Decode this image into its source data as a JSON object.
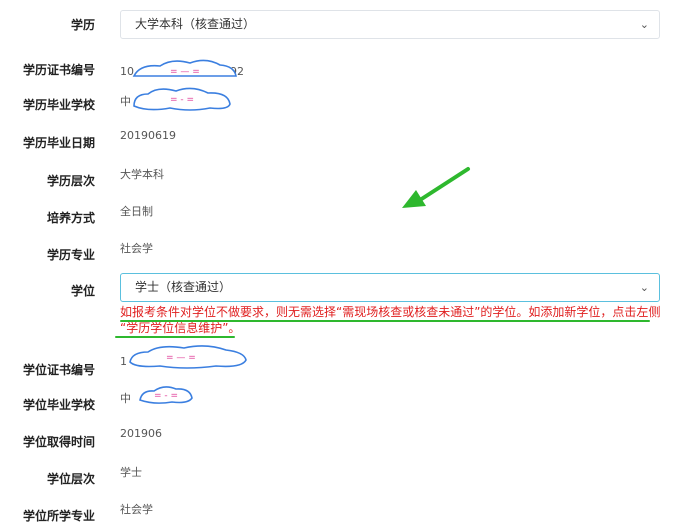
{
  "form": {
    "education": {
      "label": "学历",
      "selected": "大学本科（核查通过）"
    },
    "edu_cert_no": {
      "label": "学历证书编号",
      "value_prefix": "10",
      "value_suffix": "92"
    },
    "edu_school": {
      "label": "学历毕业学校",
      "value_prefix": "中"
    },
    "edu_grad_date": {
      "label": "学历毕业日期",
      "value": "20190619"
    },
    "edu_level": {
      "label": "学历层次",
      "value": "大学本科"
    },
    "edu_mode": {
      "label": "培养方式",
      "value": "全日制"
    },
    "edu_major": {
      "label": "学历专业",
      "value": "社会学"
    },
    "degree": {
      "label": "学位",
      "selected": "学士（核查通过）"
    },
    "degree_notice": {
      "line1": "如报考条件对学位不做要求，则无需选择“需现场核查或核查未通过”的学位。如添加新学位，点击左侧",
      "line2": "“学历学位信息维护”。"
    },
    "degree_cert_no": {
      "label": "学位证书编号",
      "value_prefix": "1"
    },
    "degree_school": {
      "label": "学位毕业学校",
      "value_prefix": "中"
    },
    "degree_date": {
      "label": "学位取得时间",
      "value": "201906"
    },
    "degree_level": {
      "label": "学位层次",
      "value": "学士"
    },
    "degree_major": {
      "label": "学位所学专业",
      "value": "社会学"
    }
  },
  "colors": {
    "annotation_green": "#2eb82e",
    "notice_red": "#e02020",
    "select_active_border": "#5bc0de"
  },
  "icons": {
    "chevron": "chevron-down-icon",
    "arrow": "green-arrow-annotation"
  }
}
